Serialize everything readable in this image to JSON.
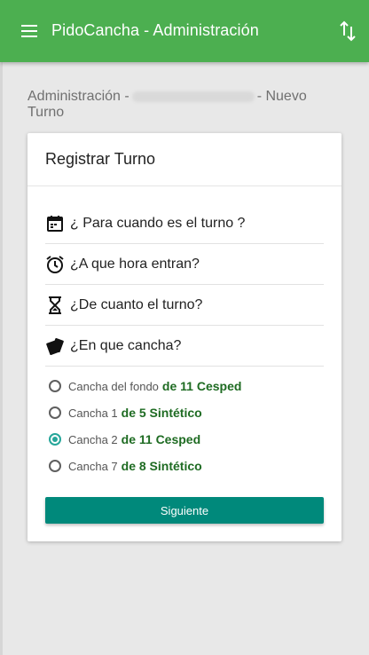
{
  "appbar": {
    "title": "PidoCancha - Administración",
    "menu_icon": "menu-icon",
    "sort_icon": "swap-vertical-icon",
    "color": "#4caf50"
  },
  "breadcrumb": {
    "prefix": "Administración -",
    "suffix": "- Nuevo Turno"
  },
  "card": {
    "title": "Registrar Turno",
    "questions": [
      {
        "icon": "calendar-icon",
        "label": "¿ Para cuando es el turno ?"
      },
      {
        "icon": "alarm-clock-icon",
        "label": "¿A que hora entran?"
      },
      {
        "icon": "hourglass-icon",
        "label": "¿De cuanto el turno?"
      },
      {
        "icon": "ticket-cards-icon",
        "label": "¿En que cancha?"
      }
    ],
    "courts": [
      {
        "name": "Cancha del fondo",
        "size": "de 11 Cesped",
        "selected": false
      },
      {
        "name": "Cancha 1",
        "size": "de 5 Sintético",
        "selected": false
      },
      {
        "name": "Cancha 2",
        "size": "de 11 Cesped",
        "selected": true
      },
      {
        "name": "Cancha 7",
        "size": "de 8 Sintético",
        "selected": false
      }
    ],
    "submit_label": "Siguiente",
    "accent_color": "#26a69a",
    "button_color": "#00897b"
  }
}
